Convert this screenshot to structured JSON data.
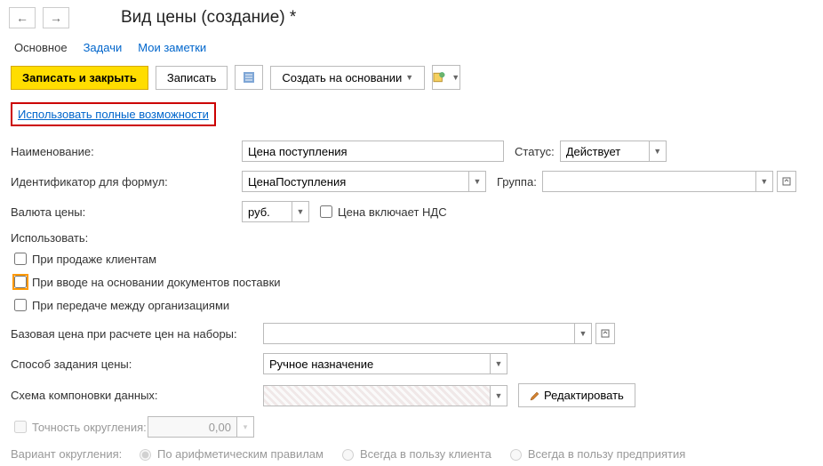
{
  "title": "Вид цены (создание) *",
  "tabs": {
    "main": "Основное",
    "tasks": "Задачи",
    "notes": "Мои заметки"
  },
  "toolbar": {
    "save_close": "Записать и закрыть",
    "save": "Записать",
    "create_based": "Создать на основании"
  },
  "link_full": "Использовать полные возможности",
  "labels": {
    "name": "Наименование:",
    "status": "Статус:",
    "formula_id": "Идентификатор для формул:",
    "group": "Группа:",
    "currency": "Валюта цены:",
    "price_incl_vat": "Цена включает НДС",
    "use_section": "Использовать:",
    "sale_clients": "При продаже клиентам",
    "supply_docs": "При вводе на основании документов поставки",
    "transfer_orgs": "При передаче между организациями",
    "base_price": "Базовая цена при расчете цен на наборы:",
    "price_method": "Способ задания цены:",
    "data_schema": "Схема компоновки данных:",
    "edit": "Редактировать",
    "rounding_precision": "Точность округления:",
    "rounding_variant": "Вариант округления:",
    "radio_arith": "По арифметическим правилам",
    "radio_client": "Всегда в пользу клиента",
    "radio_company": "Всегда в пользу предприятия"
  },
  "values": {
    "name": "Цена поступления",
    "status": "Действует",
    "formula_id": "ЦенаПоступления",
    "group": "",
    "currency": "руб.",
    "base_price": "",
    "price_method": "Ручное назначение",
    "data_schema": "",
    "rounding_precision": "0,00"
  }
}
